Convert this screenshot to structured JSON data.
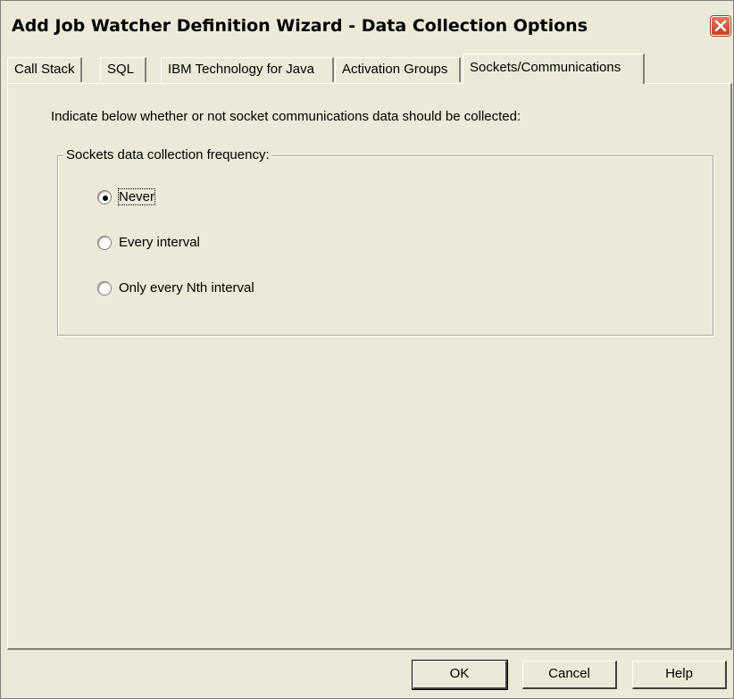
{
  "window": {
    "title": "Add Job Watcher Definition Wizard - Data Collection Options",
    "close_icon": "close-icon"
  },
  "tabs": [
    {
      "label": "Call Stack",
      "active": false
    },
    {
      "label": "SQL",
      "active": false
    },
    {
      "label": "IBM Technology for Java",
      "active": false
    },
    {
      "label": "Activation Groups",
      "active": false
    },
    {
      "label": "Sockets/Communications",
      "active": true
    }
  ],
  "panel": {
    "instruction": "Indicate below whether or not socket communications data should be collected:",
    "group_label": "Sockets data collection frequency:",
    "options": [
      {
        "label": "Never",
        "selected": true
      },
      {
        "label": "Every interval",
        "selected": false
      },
      {
        "label": "Only every Nth interval",
        "selected": false
      }
    ]
  },
  "buttons": {
    "ok": "OK",
    "cancel": "Cancel",
    "help": "Help"
  },
  "colors": {
    "background": "#ece9d8",
    "close_button": "#c1401f"
  }
}
